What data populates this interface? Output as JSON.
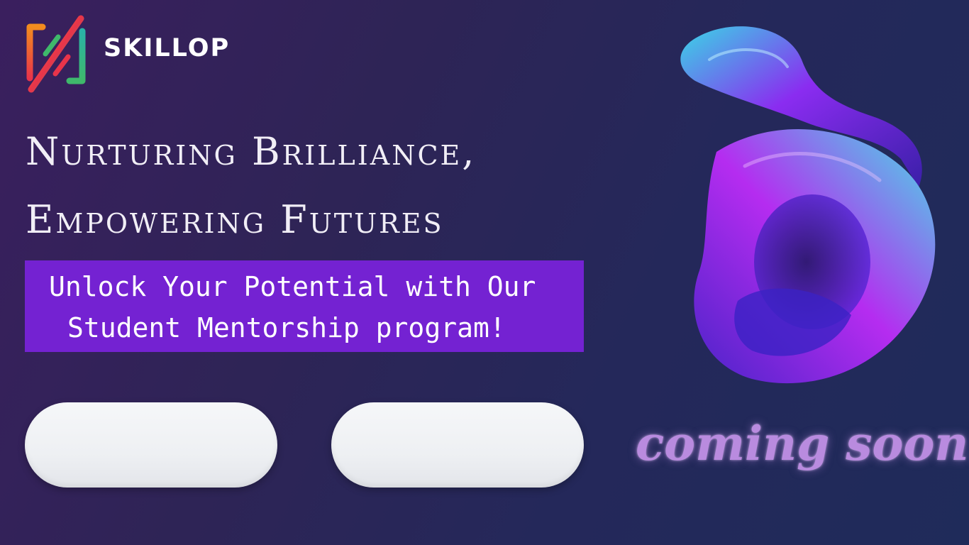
{
  "brand": {
    "name": "SKILLOP"
  },
  "hero": {
    "headline_line1": "Nurturing Brilliance,",
    "headline_line2": "Empowering Futures"
  },
  "banner": {
    "line1": "Unlock Your Potential with Our",
    "line2": "Student Mentorship program!"
  },
  "buttons": [
    {
      "label": ""
    },
    {
      "label": ""
    }
  ],
  "status": {
    "text": "coming soon!"
  },
  "colors": {
    "banner": "#7422d2",
    "coming_soon": "#b98bdf",
    "logo_orange": "#f28c1e",
    "logo_red": "#e8344a",
    "logo_green": "#3fb86b",
    "logo_teal": "#2ab3a6"
  }
}
